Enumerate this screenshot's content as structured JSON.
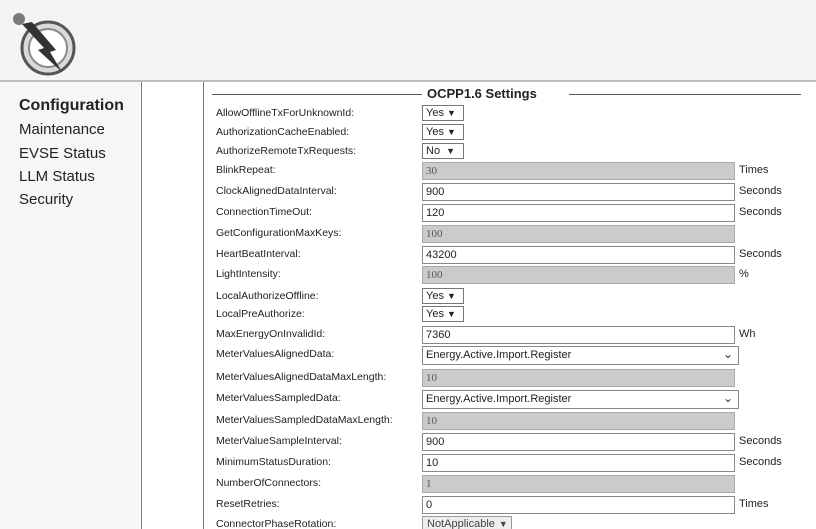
{
  "nav": {
    "items": [
      {
        "label": "Configuration",
        "active": true
      },
      {
        "label": "Maintenance"
      },
      {
        "label": "EVSE Status"
      },
      {
        "label": "LLM Status"
      },
      {
        "label": "Security"
      }
    ]
  },
  "settings": {
    "legend": "OCPP1.6 Settings",
    "rows": [
      {
        "label": "AllowOfflineTxForUnknownId:",
        "value": "Yes"
      },
      {
        "label": "AuthorizationCacheEnabled:",
        "value": "Yes"
      },
      {
        "label": "AuthorizeRemoteTxRequests:",
        "value": "No"
      },
      {
        "label": "BlinkRepeat:",
        "value": "30",
        "unit": "Times"
      },
      {
        "label": "ClockAlignedDataInterval:",
        "value": "900",
        "unit": "Seconds"
      },
      {
        "label": "ConnectionTimeOut:",
        "value": "120",
        "unit": "Seconds"
      },
      {
        "label": "GetConfigurationMaxKeys:",
        "value": "100"
      },
      {
        "label": "HeartBeatInterval:",
        "value": "43200",
        "unit": "Seconds"
      },
      {
        "label": "LightIntensity:",
        "value": "100",
        "unit": "%"
      },
      {
        "label": "LocalAuthorizeOffline:",
        "value": "Yes"
      },
      {
        "label": "LocalPreAuthorize:",
        "value": "Yes"
      },
      {
        "label": "MaxEnergyOnInvalidId:",
        "value": "7360",
        "unit": "Wh"
      },
      {
        "label": "MeterValuesAlignedData:",
        "value": "Energy.Active.Import.Register"
      },
      {
        "label": "MeterValuesAlignedDataMaxLength:",
        "value": "10"
      },
      {
        "label": "MeterValuesSampledData:",
        "value": "Energy.Active.Import.Register"
      },
      {
        "label": "MeterValuesSampledDataMaxLength:",
        "value": "10"
      },
      {
        "label": "MeterValueSampleInterval:",
        "value": "900",
        "unit": "Seconds"
      },
      {
        "label": "MinimumStatusDuration:",
        "value": "10",
        "unit": "Seconds"
      },
      {
        "label": "NumberOfConnectors:",
        "value": "1"
      },
      {
        "label": "ResetRetries:",
        "value": "0",
        "unit": "Times"
      },
      {
        "label": "ConnectorPhaseRotation:",
        "value": "NotApplicable"
      }
    ]
  },
  "icons": {
    "dropdown": "triangle-down-icon",
    "chevron": "chevron-down-icon",
    "logo": "charger-logo-icon"
  },
  "colors": {
    "header_bg": "#f4f4f4",
    "disabled_field": "#cbcbcb"
  }
}
